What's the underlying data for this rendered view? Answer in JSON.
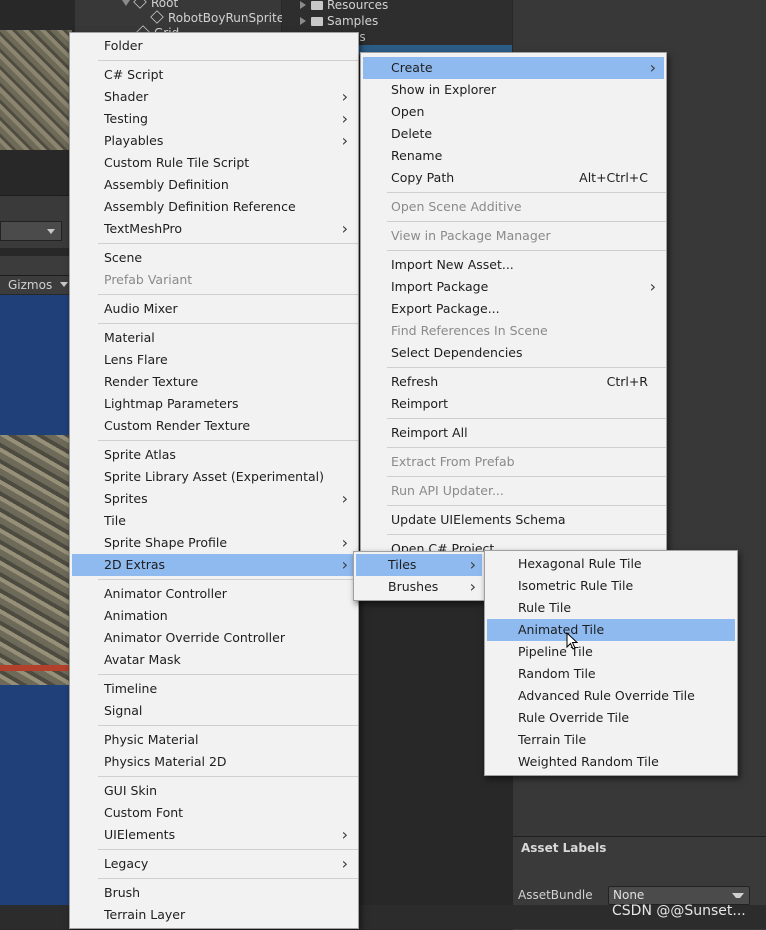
{
  "hierarchy": {
    "items": [
      "Root",
      "RobotBoyRunSprite",
      "Grid"
    ]
  },
  "project": {
    "items": [
      "Resources",
      "Samples",
      "es"
    ]
  },
  "scene": {
    "gizmos_label": "Gizmos"
  },
  "asset_labels": {
    "header": "Asset Labels",
    "assetbundle_label": "AssetBundle",
    "assetbundle_value": "None"
  },
  "watermark": "CSDN @@Sunset...",
  "create_menu": [
    {
      "label": "Folder"
    },
    {
      "sep": true
    },
    {
      "label": "C# Script"
    },
    {
      "label": "Shader",
      "sub": true
    },
    {
      "label": "Testing",
      "sub": true
    },
    {
      "label": "Playables",
      "sub": true
    },
    {
      "label": "Custom Rule Tile Script"
    },
    {
      "label": "Assembly Definition"
    },
    {
      "label": "Assembly Definition Reference"
    },
    {
      "label": "TextMeshPro",
      "sub": true
    },
    {
      "sep": true
    },
    {
      "label": "Scene"
    },
    {
      "label": "Prefab Variant",
      "disabled": true
    },
    {
      "sep": true
    },
    {
      "label": "Audio Mixer"
    },
    {
      "sep": true
    },
    {
      "label": "Material"
    },
    {
      "label": "Lens Flare"
    },
    {
      "label": "Render Texture"
    },
    {
      "label": "Lightmap Parameters"
    },
    {
      "label": "Custom Render Texture"
    },
    {
      "sep": true
    },
    {
      "label": "Sprite Atlas"
    },
    {
      "label": "Sprite Library Asset (Experimental)"
    },
    {
      "label": "Sprites",
      "sub": true
    },
    {
      "label": "Tile"
    },
    {
      "label": "Sprite Shape Profile",
      "sub": true
    },
    {
      "label": "2D Extras",
      "sub": true,
      "highlight": true
    },
    {
      "sep": true
    },
    {
      "label": "Animator Controller"
    },
    {
      "label": "Animation"
    },
    {
      "label": "Animator Override Controller"
    },
    {
      "label": "Avatar Mask"
    },
    {
      "sep": true
    },
    {
      "label": "Timeline"
    },
    {
      "label": "Signal"
    },
    {
      "sep": true
    },
    {
      "label": "Physic Material"
    },
    {
      "label": "Physics Material 2D"
    },
    {
      "sep": true
    },
    {
      "label": "GUI Skin"
    },
    {
      "label": "Custom Font"
    },
    {
      "label": "UIElements",
      "sub": true
    },
    {
      "sep": true
    },
    {
      "label": "Legacy",
      "sub": true
    },
    {
      "sep": true
    },
    {
      "label": "Brush"
    },
    {
      "label": "Terrain Layer"
    }
  ],
  "context_menu": [
    {
      "label": "Create",
      "sub": true,
      "highlight": true
    },
    {
      "label": "Show in Explorer"
    },
    {
      "label": "Open"
    },
    {
      "label": "Delete"
    },
    {
      "label": "Rename"
    },
    {
      "label": "Copy Path",
      "shortcut": "Alt+Ctrl+C"
    },
    {
      "sep": true
    },
    {
      "label": "Open Scene Additive",
      "disabled": true
    },
    {
      "sep": true
    },
    {
      "label": "View in Package Manager",
      "disabled": true
    },
    {
      "sep": true
    },
    {
      "label": "Import New Asset..."
    },
    {
      "label": "Import Package",
      "sub": true
    },
    {
      "label": "Export Package..."
    },
    {
      "label": "Find References In Scene",
      "disabled": true
    },
    {
      "label": "Select Dependencies"
    },
    {
      "sep": true
    },
    {
      "label": "Refresh",
      "shortcut": "Ctrl+R"
    },
    {
      "label": "Reimport"
    },
    {
      "sep": true
    },
    {
      "label": "Reimport All"
    },
    {
      "sep": true
    },
    {
      "label": "Extract From Prefab",
      "disabled": true
    },
    {
      "sep": true
    },
    {
      "label": "Run API Updater...",
      "disabled": true
    },
    {
      "sep": true
    },
    {
      "label": "Update UIElements Schema"
    },
    {
      "sep": true
    },
    {
      "label": "Open C# Project"
    }
  ],
  "extras_menu": [
    {
      "label": "Tiles",
      "sub": true,
      "highlight": true
    },
    {
      "label": "Brushes",
      "sub": true
    }
  ],
  "tiles_menu": [
    {
      "label": "Hexagonal Rule Tile"
    },
    {
      "label": "Isometric Rule Tile"
    },
    {
      "label": "Rule Tile"
    },
    {
      "label": "Animated Tile",
      "highlight": true
    },
    {
      "label": "Pipeline Tile"
    },
    {
      "label": "Random Tile"
    },
    {
      "label": "Advanced Rule Override Tile"
    },
    {
      "label": "Rule Override Tile"
    },
    {
      "label": "Terrain Tile"
    },
    {
      "label": "Weighted Random Tile"
    }
  ],
  "colors": {
    "menu_bg": "#f2f2f2",
    "highlight": "#8fbaf0",
    "highlight_active": "#4f93e8",
    "disabled_text": "#8a8a8a"
  }
}
